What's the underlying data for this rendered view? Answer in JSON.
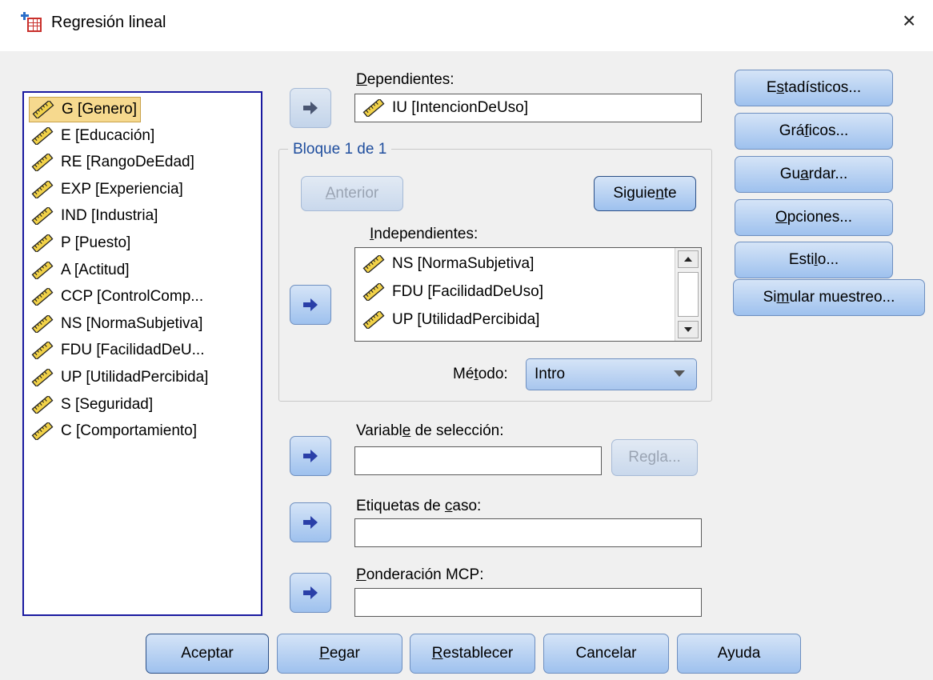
{
  "window": {
    "title": "Regresión lineal",
    "close_glyph": "×",
    "app_icon": "spss-regression-icon"
  },
  "variables": [
    {
      "label": "G [Genero]",
      "selected": true
    },
    {
      "label": "E [Educación]"
    },
    {
      "label": "RE [RangoDeEdad]"
    },
    {
      "label": "EXP [Experiencia]"
    },
    {
      "label": "IND [Industria]"
    },
    {
      "label": "P [Puesto]"
    },
    {
      "label": "A [Actitud]"
    },
    {
      "label": "CCP [ControlComp..."
    },
    {
      "label": "NS [NormaSubjetiva]"
    },
    {
      "label": "FDU [FacilidadDeU..."
    },
    {
      "label": "UP [UtilidadPercibida]"
    },
    {
      "label": "S [Seguridad]"
    },
    {
      "label": "C [Comportamiento]"
    }
  ],
  "dependents": {
    "label": "Dependientes:",
    "value": "IU [IntencionDeUso]"
  },
  "block": {
    "title": "Bloque 1 de 1",
    "prev_label": "Anterior",
    "next_label": "Siguiente",
    "independents_label": "Independientes:",
    "independents": [
      "NS [NormaSubjetiva]",
      "FDU [FacilidadDeUso]",
      "UP [UtilidadPercibida]"
    ],
    "method_label": "Método:",
    "method_value": "Intro"
  },
  "selection": {
    "label": "Variable de selección:",
    "rule_label": "Regla..."
  },
  "case_labels": {
    "label": "Etiquetas de caso:"
  },
  "wls": {
    "label": "Ponderación MCP:"
  },
  "side_buttons": [
    "Estadísticos...",
    "Gráficos...",
    "Guardar...",
    "Opciones...",
    "Estilo...",
    "Simular muestreo..."
  ],
  "bottom_buttons": [
    "Aceptar",
    "Pegar",
    "Restablecer",
    "Cancelar",
    "Ayuda"
  ],
  "colors": {
    "accent": "#1a1aa0",
    "button_top": "#d5e4f7",
    "button_bottom": "#9ec1ee",
    "selection": "#f6d98e",
    "arrow": "#2a3fa8"
  }
}
